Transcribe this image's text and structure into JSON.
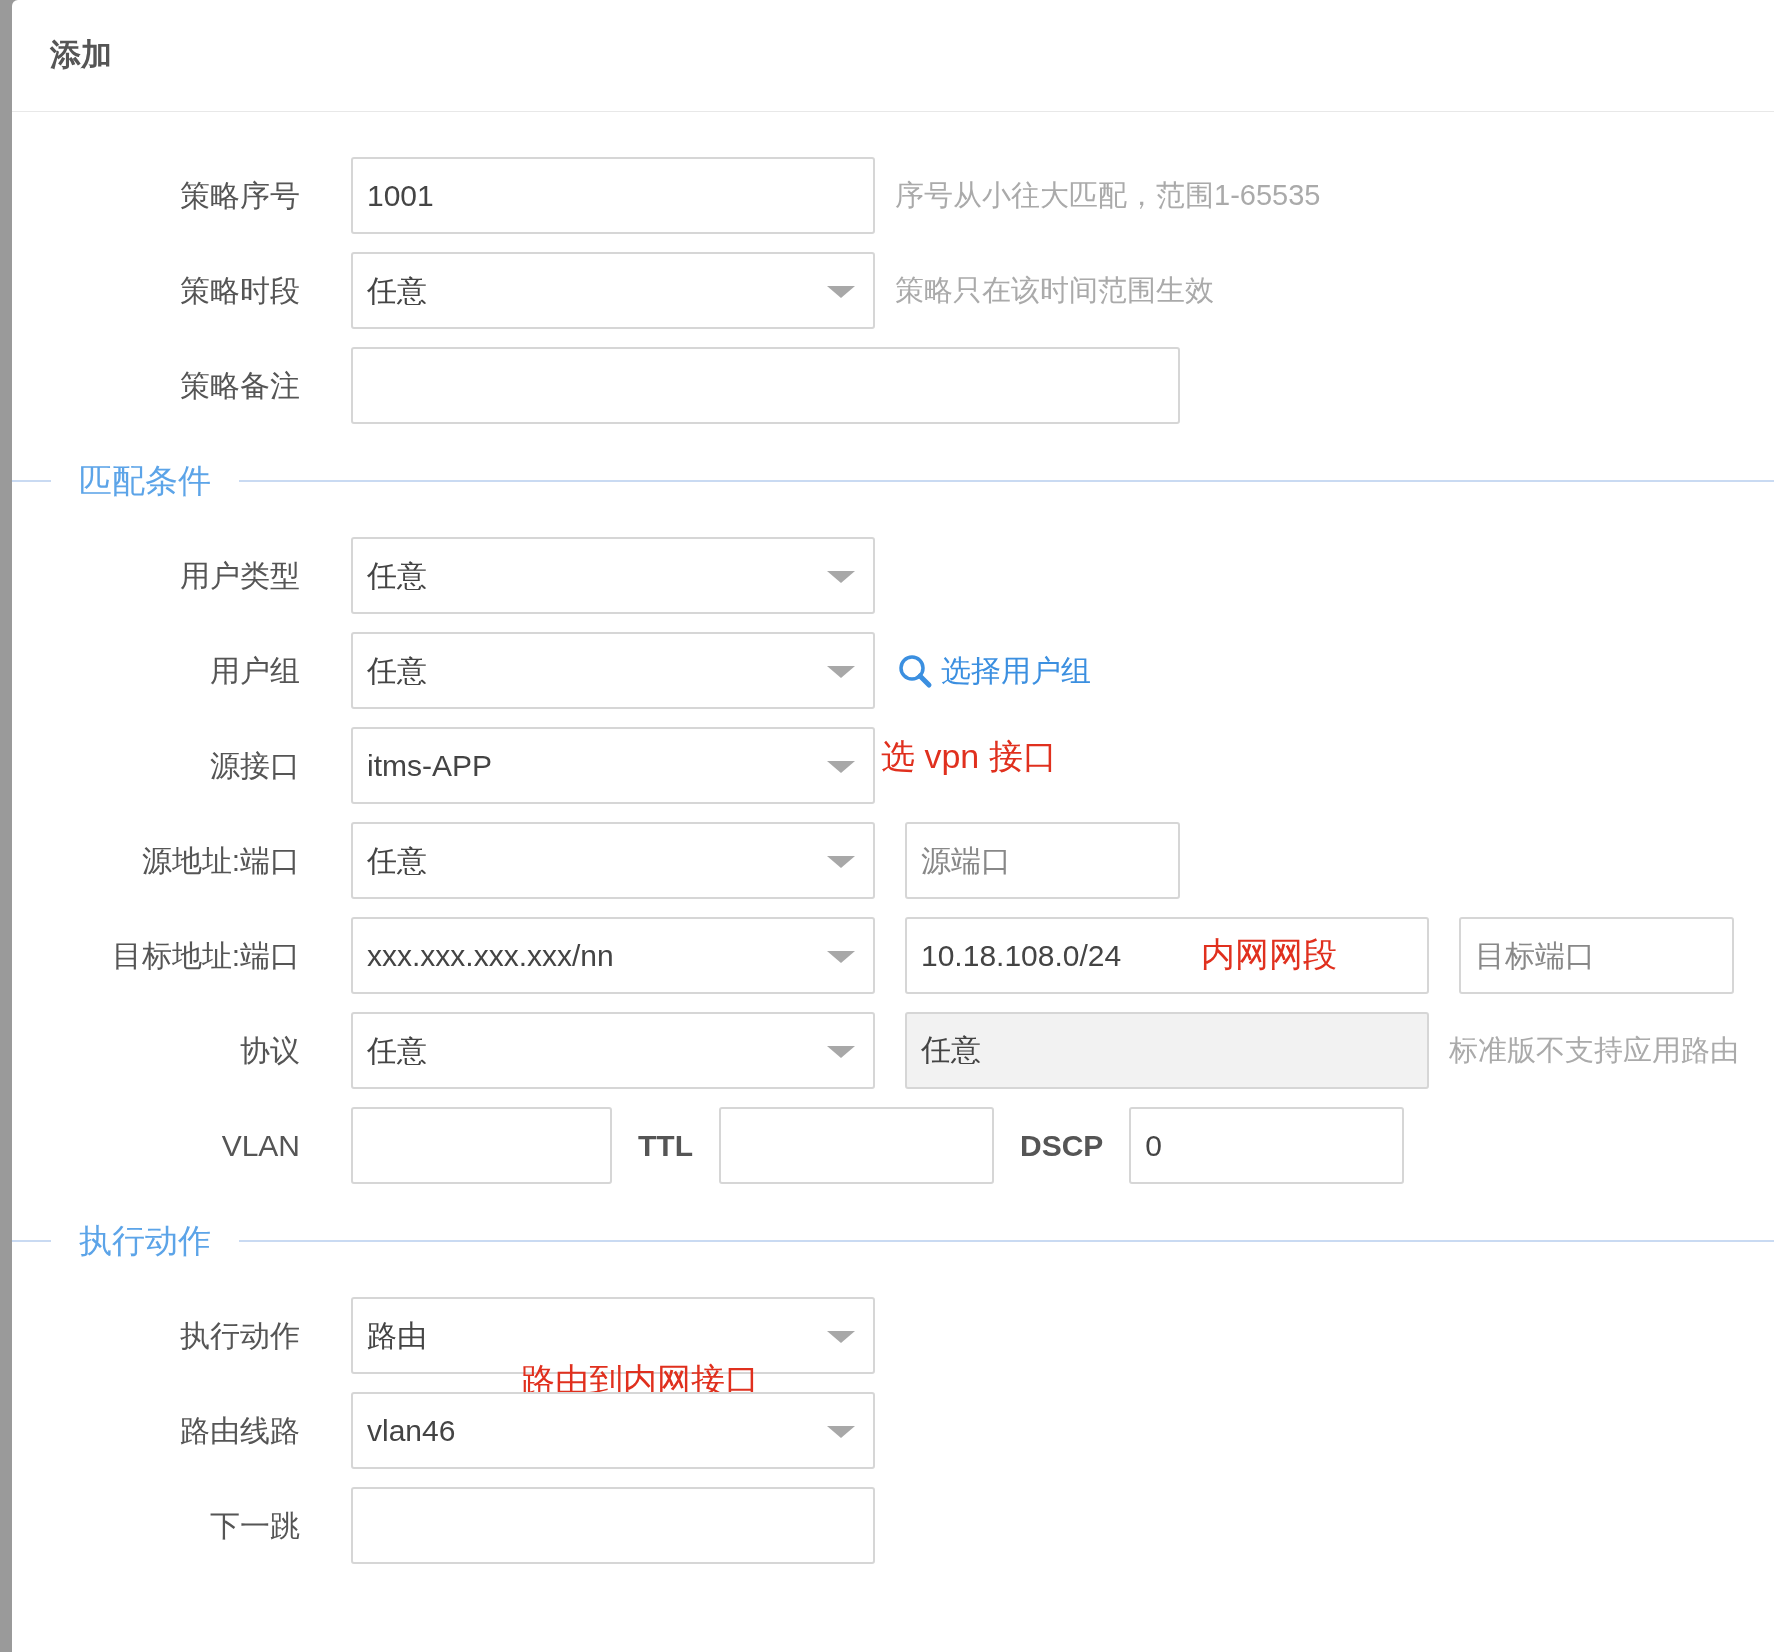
{
  "dialog": {
    "title": "添加"
  },
  "groups": [
    {
      "rows": [
        {
          "label": "策略序号",
          "controls": [
            {
              "kind": "text",
              "value": "1001",
              "disabled": false
            }
          ],
          "hint": "序号从小往大匹配，范围1-65535"
        },
        {
          "label": "策略时段",
          "controls": [
            {
              "kind": "select",
              "value": "任意",
              "disabled": false
            }
          ],
          "hint": "策略只在该时间范围生效"
        },
        {
          "label": "策略备注",
          "controls": [
            {
              "kind": "wide-text",
              "disabled": false
            }
          ]
        }
      ]
    },
    {
      "heading": "匹配条件",
      "rows": [
        {
          "label": "用户类型",
          "controls": [
            {
              "kind": "select",
              "value": "任意",
              "disabled": false
            }
          ]
        },
        {
          "label": "用户组",
          "controls": [
            {
              "kind": "select",
              "value": "任意",
              "disabled": false
            }
          ],
          "link": "选择用户组"
        },
        {
          "label": "源接口",
          "controls": [
            {
              "kind": "select",
              "value": "itms-APP",
              "disabled": false
            }
          ],
          "annotation": {
            "kind": "after",
            "text": "选 vpn 接口"
          }
        },
        {
          "label": "源地址:端口",
          "controls": [
            {
              "kind": "select",
              "value": "任意",
              "disabled": false
            },
            {
              "kind": "short-text",
              "placeholder": "源端口",
              "disabled": false
            }
          ]
        },
        {
          "label": "目标地址:端口",
          "controls": [
            {
              "kind": "select",
              "value": "xxx.xxx.xxx.xxx/nn",
              "disabled": false
            },
            {
              "kind": "text",
              "value": "10.18.108.0/24",
              "disabled": false,
              "annotation": {
                "kind": "inside",
                "text": "内网网段"
              }
            },
            {
              "kind": "short-text",
              "placeholder": "目标端口",
              "disabled": false
            }
          ]
        },
        {
          "label": "协议",
          "controls": [
            {
              "kind": "select",
              "value": "任意",
              "disabled": false
            },
            {
              "kind": "text",
              "value": "任意",
              "disabled": true
            }
          ],
          "hint": "标准版不支持应用路由"
        },
        {
          "label": "VLAN",
          "controls": [
            {
              "kind": "vlan-text",
              "disabled": false
            },
            {
              "kind": "inline-label",
              "text": "TTL"
            },
            {
              "kind": "short-text",
              "disabled": false
            },
            {
              "kind": "inline-label",
              "text": "DSCP"
            },
            {
              "kind": "short-text",
              "value": "0",
              "disabled": false
            }
          ]
        }
      ]
    },
    {
      "heading": "执行动作",
      "rows": [
        {
          "label": "执行动作",
          "controls": [
            {
              "kind": "select",
              "value": "路由",
              "disabled": false
            }
          ],
          "annotation": {
            "kind": "below",
            "text": "路由到内网接口"
          }
        },
        {
          "label": "路由线路",
          "controls": [
            {
              "kind": "select",
              "value": "vlan46",
              "disabled": false
            }
          ]
        },
        {
          "label": "下一跳",
          "controls": [
            {
              "kind": "text",
              "disabled": false
            }
          ]
        }
      ]
    }
  ]
}
